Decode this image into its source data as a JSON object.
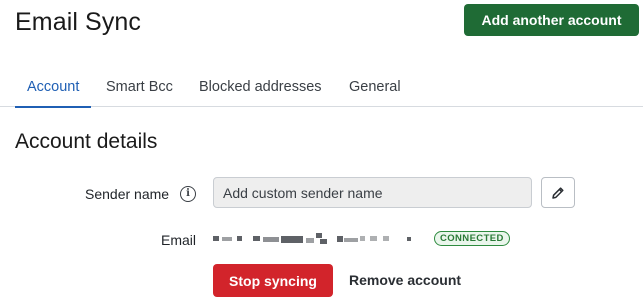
{
  "header": {
    "title": "Email Sync",
    "add_account_label": "Add another account"
  },
  "tabs": [
    {
      "label": "Account",
      "active": true
    },
    {
      "label": "Smart Bcc",
      "active": false
    },
    {
      "label": "Blocked addresses",
      "active": false
    },
    {
      "label": "General",
      "active": false
    }
  ],
  "account": {
    "section_title": "Account details",
    "sender_label": "Sender name",
    "sender_placeholder": "Add custom sender name",
    "sender_value": "",
    "email_label": "Email",
    "status_badge": "CONNECTED",
    "stop_syncing_label": "Stop syncing",
    "remove_account_label": "Remove account"
  },
  "colors": {
    "primary": "#1f6b35",
    "accent": "#1f5fb4",
    "danger": "#d2242b",
    "success": "#2a7a37"
  },
  "icons": {
    "info": "info-icon",
    "edit": "pencil-icon"
  }
}
